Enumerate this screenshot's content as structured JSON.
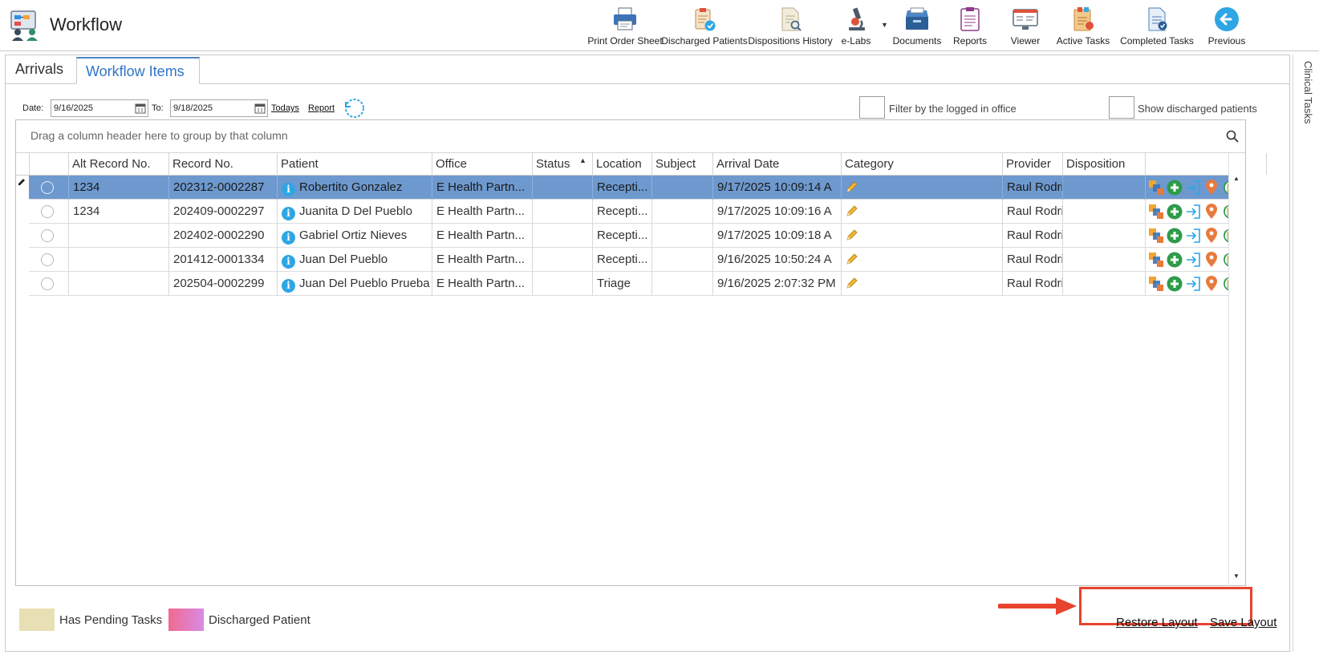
{
  "app": {
    "title": "Workflow"
  },
  "toolbar": [
    {
      "id": "print-order-sheet",
      "label": "Print Order Sheet",
      "icon": "printer-icon"
    },
    {
      "id": "discharged-patients",
      "label": "Discharged Patients",
      "icon": "clipboard-check-icon"
    },
    {
      "id": "dispositions-history",
      "label": "Dispositions History",
      "icon": "document-search-icon"
    },
    {
      "id": "e-labs",
      "label": "e-Labs",
      "icon": "microscope-icon"
    },
    {
      "id": "documents",
      "label": "Documents",
      "icon": "file-cabinet-icon"
    },
    {
      "id": "reports",
      "label": "Reports",
      "icon": "report-icon"
    },
    {
      "id": "viewer",
      "label": "Viewer",
      "icon": "viewer-icon"
    },
    {
      "id": "active-tasks",
      "label": "Active Tasks",
      "icon": "tasks-icon"
    },
    {
      "id": "completed-tasks",
      "label": "Completed Tasks",
      "icon": "completed-tasks-icon"
    },
    {
      "id": "previous",
      "label": "Previous",
      "icon": "arrow-left-icon"
    }
  ],
  "side_tab": "Clinical Tasks",
  "tabs": [
    {
      "label": "Arrivals",
      "active": false
    },
    {
      "label": "Workflow Items",
      "active": true
    }
  ],
  "filters": {
    "date_label": "Date:",
    "date_from": "9/16/2025",
    "to_label": "To:",
    "date_to": "9/18/2025",
    "todays_link": "Todays",
    "report_link": "Report",
    "filter_office_label": "Filter by the logged in office",
    "show_discharged_label": "Show discharged patients"
  },
  "grid": {
    "group_panel_text": "Drag a column header here to group by that column",
    "columns": [
      "Alt Record No.",
      "Record No.",
      "Patient",
      "Office",
      "Status",
      "Location",
      "Subject",
      "Arrival Date",
      "Category",
      "Provider",
      "Disposition"
    ],
    "sorted_column": "Status",
    "rows": [
      {
        "alt": "1234",
        "record": "202312-0002287",
        "patient": "Robertito Gonzalez",
        "office": "E Health Partn...",
        "status": "",
        "location": "Recepti...",
        "subject": "",
        "arrival": "9/17/2025 10:09:14 A",
        "provider": "Raul Rodri",
        "disposition": "",
        "selected": true
      },
      {
        "alt": "1234",
        "record": "202409-0002297",
        "patient": "Juanita D Del Pueblo",
        "office": "E Health Partn...",
        "status": "",
        "location": "Recepti...",
        "subject": "",
        "arrival": "9/17/2025 10:09:16 A",
        "provider": "Raul Rodri",
        "disposition": "",
        "selected": false
      },
      {
        "alt": "",
        "record": "202402-0002290",
        "patient": "Gabriel Ortiz Nieves",
        "office": "E Health Partn...",
        "status": "",
        "location": "Recepti...",
        "subject": "",
        "arrival": "9/17/2025 10:09:18 A",
        "provider": "Raul Rodri",
        "disposition": "",
        "selected": false
      },
      {
        "alt": "",
        "record": "201412-0001334",
        "patient": "Juan Del Pueblo",
        "office": "E Health Partn...",
        "status": "",
        "location": "Recepti...",
        "subject": "",
        "arrival": "9/16/2025 10:50:24 A",
        "provider": "Raul Rodri",
        "disposition": "",
        "selected": false
      },
      {
        "alt": "",
        "record": "202504-0002299",
        "patient": "Juan Del Pueblo Prueba",
        "office": "E Health Partn...",
        "status": "",
        "location": "Triage",
        "subject": "",
        "arrival": "9/16/2025 2:07:32 PM",
        "provider": "Raul Rodri",
        "disposition": "",
        "selected": false
      }
    ]
  },
  "legend": [
    {
      "label": "Has Pending Tasks",
      "color": "#e8e0b4"
    },
    {
      "label": "Discharged Patient",
      "color_from": "#f06a8f",
      "color_to": "#d98be6"
    }
  ],
  "footer": {
    "restore_layout": "Restore Layout",
    "save_layout": "Save Layout"
  },
  "colors": {
    "selected_row": "#6d99cf",
    "active_tab": "#2f75c6",
    "annotation_red": "#e8432d"
  }
}
